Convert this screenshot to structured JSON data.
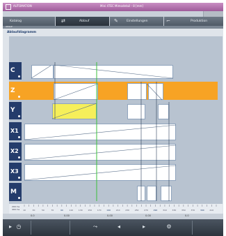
{
  "titlebar": {
    "app_name": "AUTOMATION",
    "center_text": "Mini 4TEC Mimodetail - 8 [mm]"
  },
  "tabs": [
    {
      "label": "Katalog",
      "icon": "folder-icon"
    },
    {
      "label": "Ablauf",
      "icon": "flow-icon",
      "active": true
    },
    {
      "label": "Einstellungen",
      "icon": "settings-icon"
    },
    {
      "label": "Produktion",
      "icon": "production-icon"
    }
  ],
  "subtab": {
    "label": "Ablauf"
  },
  "section_title": "Ablaufdiagramm",
  "axes": [
    {
      "label": "C",
      "active": false
    },
    {
      "label": "Z",
      "active": true
    },
    {
      "label": "Y",
      "active": false
    },
    {
      "label": "X1",
      "active": false
    },
    {
      "label": "X2",
      "active": false
    },
    {
      "label": "X3",
      "active": false
    },
    {
      "label": "M",
      "active": false
    }
  ],
  "ruler": {
    "label_top": "200 ms",
    "label_bottom": "400 ms",
    "ticks": [
      "10",
      "20",
      "30",
      "40",
      "50",
      "60",
      "70",
      "80",
      "90",
      "100",
      "110",
      "120",
      "130",
      "140",
      "150",
      "160",
      "170",
      "180",
      "190",
      "200",
      "210",
      "220",
      "230",
      "240",
      "250",
      "260",
      "270",
      "280",
      "290",
      "300",
      "310",
      "320",
      "330",
      "340",
      "350",
      "360",
      "370",
      "380",
      "390",
      "400",
      "410",
      "420"
    ]
  },
  "status": {
    "items": [
      "0.0",
      "0.00",
      "0.00",
      "0.00",
      "0.0"
    ]
  },
  "bottom_toolbar": {
    "buttons": [
      "play-icon",
      "clock-icon",
      "step-icon",
      "back-icon",
      "forward-icon",
      "settings-icon"
    ]
  },
  "colors": {
    "active_axis": "#f7a324",
    "axis": "#243c6b",
    "green_marker": "#3bbf3b",
    "yellow_block": "#f6ef5a"
  }
}
